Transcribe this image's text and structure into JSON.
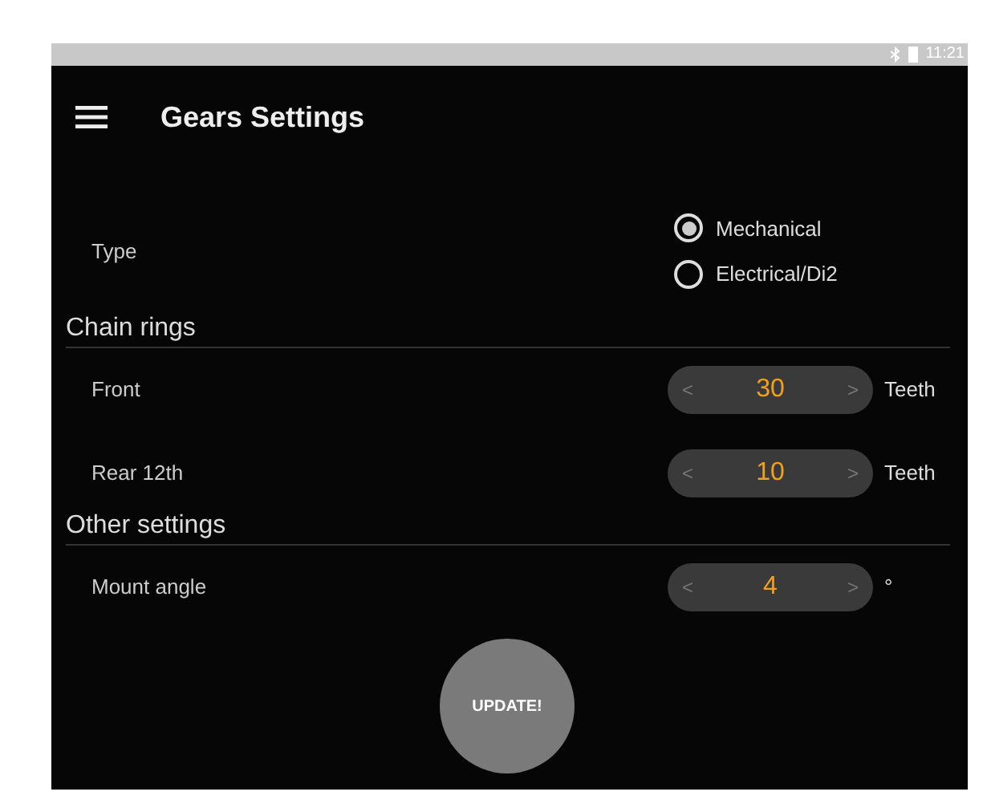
{
  "status_bar": {
    "time": "11:21"
  },
  "toolbar": {
    "title": "Gears Settings"
  },
  "type_setting": {
    "label": "Type",
    "options": [
      {
        "label": "Mechanical",
        "selected": true
      },
      {
        "label": "Electrical/Di2",
        "selected": false
      }
    ]
  },
  "sections": [
    {
      "title": "Chain rings",
      "rows": [
        {
          "label": "Front",
          "decrement": "<",
          "value": "30",
          "increment": ">",
          "unit": "Teeth"
        },
        {
          "label": "Rear 12th",
          "decrement": "<",
          "value": "10",
          "increment": ">",
          "unit": "Teeth"
        }
      ]
    },
    {
      "title": "Other settings",
      "rows": [
        {
          "label": "Mount angle",
          "decrement": "<",
          "value": "4",
          "increment": ">",
          "unit": "°"
        }
      ]
    }
  ],
  "update_button": {
    "label": "UPDATE!"
  }
}
